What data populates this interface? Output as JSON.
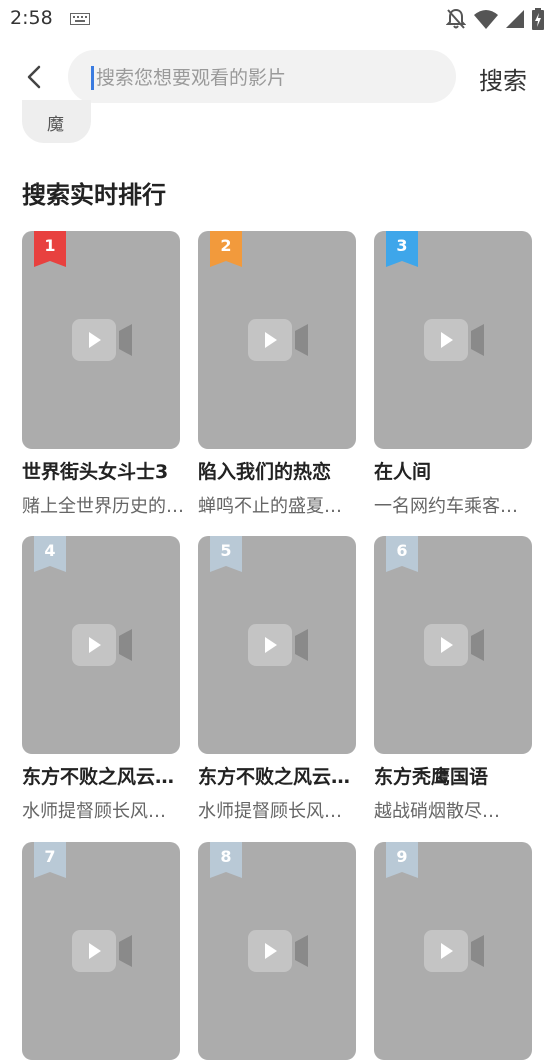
{
  "status_bar": {
    "time": "2:58"
  },
  "search": {
    "placeholder": "搜索您想要观看的影片",
    "value": "",
    "button_label": "搜索"
  },
  "history": {
    "chip_label": "魔"
  },
  "ranking": {
    "title": "搜索实时排行",
    "items": [
      {
        "rank": "1",
        "title": "世界街头女斗士3",
        "desc": "赌上全世界历史的…",
        "badge_color": "#e8413f"
      },
      {
        "rank": "2",
        "title": "陷入我们的热恋",
        "desc": "蝉鸣不止的盛夏…",
        "badge_color": "#f29a3c"
      },
      {
        "rank": "3",
        "title": "在人间",
        "desc": "一名网约车乘客…",
        "badge_color": "#3ea6ea"
      },
      {
        "rank": "4",
        "title": "东方不败之风云…",
        "desc": "水师提督顾长风…",
        "badge_color": "#b9c9d6"
      },
      {
        "rank": "5",
        "title": "东方不败之风云…",
        "desc": "水师提督顾长风…",
        "badge_color": "#b9c9d6"
      },
      {
        "rank": "6",
        "title": "东方秃鹰国语",
        "desc": "越战硝烟散尽…",
        "badge_color": "#b9c9d6"
      },
      {
        "rank": "7",
        "title": "",
        "desc": "",
        "badge_color": "#b9c9d6"
      },
      {
        "rank": "8",
        "title": "",
        "desc": "",
        "badge_color": "#b9c9d6"
      },
      {
        "rank": "9",
        "title": "",
        "desc": "",
        "badge_color": "#b9c9d6"
      }
    ]
  }
}
